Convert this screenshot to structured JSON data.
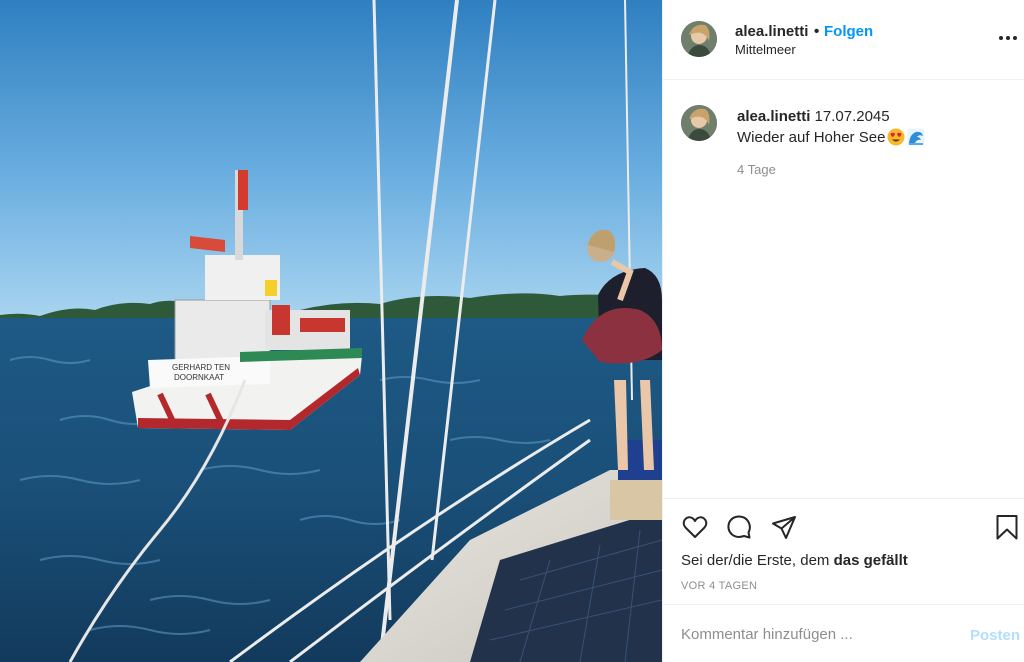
{
  "post": {
    "image_alt": "Segelboot schleppt Rettungsboot auf dem Meer",
    "boat_name_line1": "GERHARD TEN",
    "boat_name_line2": "DOORNKAAT"
  },
  "header": {
    "username": "alea.linetti",
    "separator": "•",
    "follow_label": "Folgen",
    "location": "Mittelmeer",
    "more_icon": "more-dots-icon"
  },
  "caption": {
    "username": "alea.linetti",
    "date": "17.07.2045",
    "text": "Wieder auf Hoher See",
    "emojis": [
      "heart-eyes-emoji",
      "wave-emoji"
    ],
    "time": "4 Tage"
  },
  "actions": {
    "icons": [
      "heart-icon",
      "comment-icon",
      "share-icon",
      "bookmark-icon"
    ],
    "likes_prefix": "Sei der/die Erste, dem ",
    "likes_bold": "das gefällt",
    "timestamp": "VOR 4 TAGEN"
  },
  "comment": {
    "placeholder": "Kommentar hinzufügen ...",
    "post_label": "Posten"
  },
  "colors": {
    "link": "#0095f6",
    "post_disabled": "#b2dffc",
    "muted": "#8e8e8e",
    "text": "#262626"
  }
}
